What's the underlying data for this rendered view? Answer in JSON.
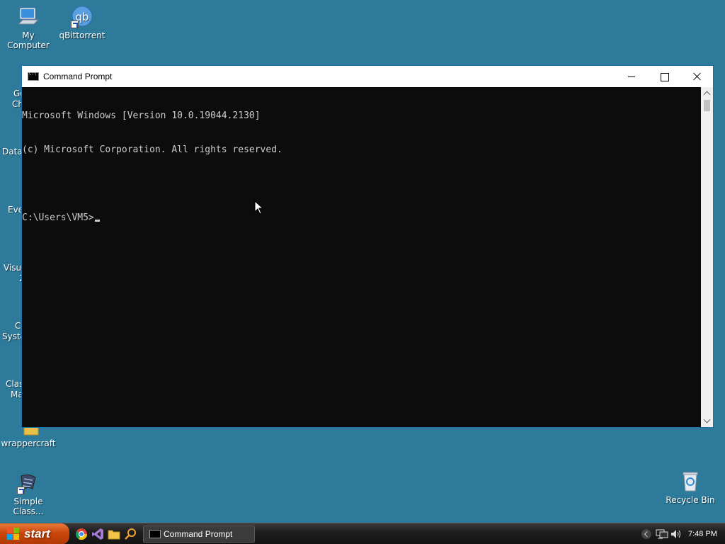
{
  "desktop": {
    "background": "#2e7a9a",
    "icons": [
      {
        "label": "My Computer",
        "icon": "computer-icon"
      },
      {
        "label": "qBittorrent",
        "icon": "qbittorrent-icon",
        "glyph": "qb"
      },
      {
        "label": "wrappercraft",
        "icon": "folder-icon"
      },
      {
        "label": "Simple Class...",
        "icon": "simple-class-icon"
      },
      {
        "label": "Recycle Bin",
        "icon": "recycle-bin-icon"
      }
    ],
    "partial_labels": [
      {
        "text": "Go"
      },
      {
        "text": "Ch"
      },
      {
        "text": "Data\\"
      },
      {
        "text": "Eve"
      },
      {
        "text": "Visua"
      },
      {
        "text": "2"
      },
      {
        "text": "Cl"
      },
      {
        "text": "Syste"
      },
      {
        "text": "Clas"
      },
      {
        "text": "Ma"
      }
    ]
  },
  "window": {
    "title": "Command Prompt",
    "console_lines": [
      "Microsoft Windows [Version 10.0.19044.2130]",
      "(c) Microsoft Corporation. All rights reserved.",
      "",
      "C:\\Users\\VM5>"
    ],
    "console_bg": "#0c0c0c",
    "console_fg": "#cccccc"
  },
  "taskbar": {
    "start_label": "start",
    "quick_launch": [
      {
        "name": "chrome-icon"
      },
      {
        "name": "visual-studio-icon"
      },
      {
        "name": "file-explorer-icon"
      },
      {
        "name": "search-icon"
      }
    ],
    "active_task": "Command Prompt",
    "clock": "7:48 PM"
  }
}
